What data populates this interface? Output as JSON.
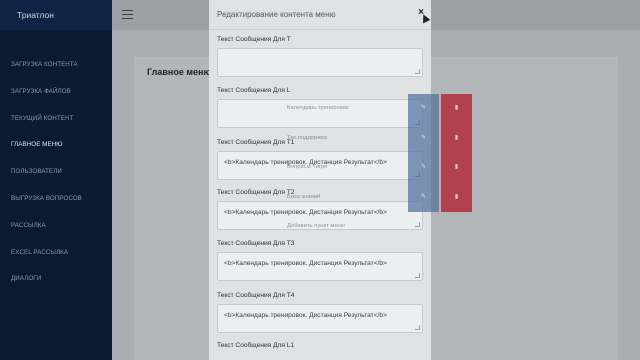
{
  "app": {
    "title": "Триатлон"
  },
  "sidebar": {
    "items": [
      {
        "label": "ЗАГРУЗКА КОНТЕНТА"
      },
      {
        "label": "ЗАГРУЗКА ФАЙЛОВ"
      },
      {
        "label": "ТЕКУЩИЙ КОНТЕНТ"
      },
      {
        "label": "ГЛАВНОЕ МЕНЮ"
      },
      {
        "label": "ПОЛЬЗОВАТЕЛИ"
      },
      {
        "label": "ВЫГРУЗКА ВОПРОСОВ"
      },
      {
        "label": "РАССЫЛКА"
      },
      {
        "label": "EXCEL РАССЫЛКА"
      },
      {
        "label": "ДИАЛОГИ"
      }
    ]
  },
  "main": {
    "panel_title": "Главное меню",
    "menu_items": [
      {
        "label": "Календарь тренировок"
      },
      {
        "label": "Тех.поддержка"
      },
      {
        "label": "Вопросы Тигре"
      },
      {
        "label": "База знаний"
      }
    ],
    "add_item_label": "Добавить пункт меню"
  },
  "modal": {
    "title": "Редактирование контента меню",
    "close_label": "×",
    "fields": [
      {
        "label": "Текст Сообщения Для Т",
        "value": ""
      },
      {
        "label": "Текст Сообщения Для L",
        "value": ""
      },
      {
        "label": "Текст Сообщения Для T1",
        "value": "<b>Календарь тренировок. Дистанция Результат</b>"
      },
      {
        "label": "Текст Сообщения Для T2",
        "value": "<b>Календарь тренировок. Дистанция Результат</b>"
      },
      {
        "label": "Текст Сообщения Для T3",
        "value": "<b>Календарь тренировок. Дистанция Результат</b>"
      },
      {
        "label": "Текст Сообщения Для T4",
        "value": "<b>Календарь тренировок. Дистанция Результат</b>"
      },
      {
        "label": "Текст Сообщения Для L1",
        "value": ""
      }
    ]
  },
  "icons": {
    "edit": "edit-icon",
    "delete": "trash-icon",
    "menu": "hamburger-icon"
  },
  "colors": {
    "sidebar_bg": "#0b1a33",
    "edit_btn": "#4f6f9c",
    "delete_btn": "#9b2f38"
  }
}
